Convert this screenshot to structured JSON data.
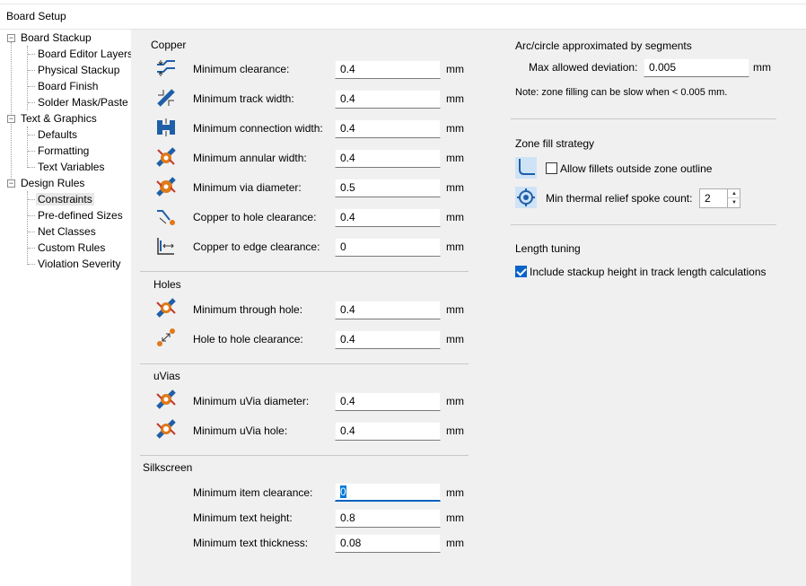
{
  "window": {
    "title": "Board Setup"
  },
  "tree": {
    "items": [
      {
        "label": "Board Stackup"
      },
      {
        "label": "Board Editor Layers"
      },
      {
        "label": "Physical Stackup"
      },
      {
        "label": "Board Finish"
      },
      {
        "label": "Solder Mask/Paste"
      },
      {
        "label": "Text & Graphics"
      },
      {
        "label": "Defaults"
      },
      {
        "label": "Formatting"
      },
      {
        "label": "Text Variables"
      },
      {
        "label": "Design Rules"
      },
      {
        "label": "Constraints"
      },
      {
        "label": "Pre-defined Sizes"
      },
      {
        "label": "Net Classes"
      },
      {
        "label": "Custom Rules"
      },
      {
        "label": "Violation Severity"
      }
    ],
    "expander_symbol": "−"
  },
  "copper": {
    "title": "Copper",
    "rows": [
      {
        "label": "Minimum clearance:",
        "value": "0.4",
        "unit": "mm",
        "icon": "clearance-icon"
      },
      {
        "label": "Minimum track width:",
        "value": "0.4",
        "unit": "mm",
        "icon": "track-width-icon"
      },
      {
        "label": "Minimum connection width:",
        "value": "0.4",
        "unit": "mm",
        "icon": "connection-width-icon"
      },
      {
        "label": "Minimum annular width:",
        "value": "0.4",
        "unit": "mm",
        "icon": "annular-width-icon"
      },
      {
        "label": "Minimum via diameter:",
        "value": "0.5",
        "unit": "mm",
        "icon": "via-diameter-icon"
      },
      {
        "label": "Copper to hole clearance:",
        "value": "0.4",
        "unit": "mm",
        "icon": "copper-hole-clearance-icon"
      },
      {
        "label": "Copper to edge clearance:",
        "value": "0",
        "unit": "mm",
        "icon": "copper-edge-clearance-icon"
      }
    ]
  },
  "holes": {
    "title": "Holes",
    "rows": [
      {
        "label": "Minimum through hole:",
        "value": "0.4",
        "unit": "mm",
        "icon": "through-hole-icon"
      },
      {
        "label": "Hole to hole clearance:",
        "value": "0.4",
        "unit": "mm",
        "icon": "hole-to-hole-icon"
      }
    ]
  },
  "uvias": {
    "title": "uVias",
    "rows": [
      {
        "label": "Minimum uVia diameter:",
        "value": "0.4",
        "unit": "mm",
        "icon": "uvia-diameter-icon"
      },
      {
        "label": "Minimum uVia hole:",
        "value": "0.4",
        "unit": "mm",
        "icon": "uvia-hole-icon"
      }
    ]
  },
  "silkscreen": {
    "title": "Silkscreen",
    "rows": [
      {
        "label": "Minimum item clearance:",
        "value": "0",
        "unit": "mm"
      },
      {
        "label": "Minimum text height:",
        "value": "0.8",
        "unit": "mm"
      },
      {
        "label": "Minimum text thickness:",
        "value": "0.08",
        "unit": "mm"
      }
    ]
  },
  "arc": {
    "title": "Arc/circle approximated by segments",
    "max_dev_label": "Max allowed deviation:",
    "max_dev_value": "0.005",
    "max_dev_unit": "mm",
    "note": "Note: zone filling can be slow when < 0.005 mm."
  },
  "zone": {
    "title": "Zone fill strategy",
    "allow_fillets_label": "Allow fillets outside zone outline",
    "allow_fillets_checked": false,
    "spoke_label": "Min thermal relief spoke count:",
    "spoke_value": "2"
  },
  "length": {
    "title": "Length tuning",
    "include_stackup_label": "Include stackup height in track length calculations",
    "include_stackup_checked": true
  },
  "colors": {
    "accent": "#0a64c8",
    "icon_blue": "#1f5fa8",
    "icon_orange": "#e07a1a",
    "icon_red": "#c0392b"
  }
}
